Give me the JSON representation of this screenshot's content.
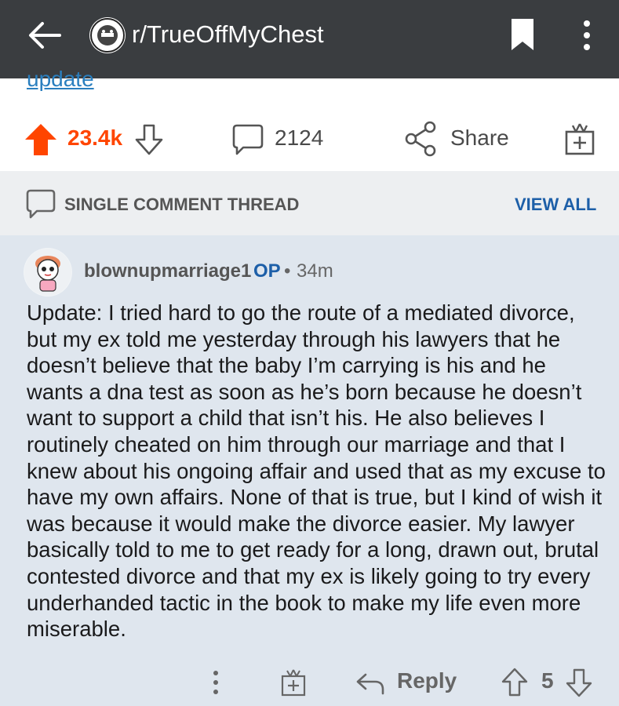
{
  "appbar": {
    "subreddit": "r/TrueOffMyChest"
  },
  "post": {
    "cutoff_text": "update",
    "score": "23.4k",
    "comment_count": "2124",
    "share_label": "Share"
  },
  "thread": {
    "label": "SINGLE COMMENT THREAD",
    "view_all": "VIEW ALL"
  },
  "comment": {
    "username": "blownupmarriage1",
    "op_badge": "OP",
    "separator": "•",
    "time": "34m",
    "body": "Update: I tried hard to go the route of a mediated divorce, but my ex told me yesterday through his lawyers that he doesn’t believe that the baby I’m carrying is his and he wants a dna test as soon as he’s born because he doesn’t want to support a child that isn’t his. He also believes I routinely cheated on him through our marriage and that I knew about his ongoing affair and used that as my excuse to have my own affairs. None of that is true, but I kind of wish it was because it would make the divorce easier. My lawyer basically told to me to get ready for a long, drawn out, brutal contested divorce and that my ex is likely going to try every underhanded tactic in the book to make my life even more miserable.",
    "reply_label": "Reply",
    "score": "5"
  },
  "colors": {
    "appbar": "#3a3d40",
    "upvote": "#ff4500",
    "link_blue": "#1d5fa8",
    "comment_bg": "#dfe6ee"
  },
  "icons": [
    "back-arrow-icon",
    "subreddit-avatar-icon",
    "bookmark-icon",
    "more-vertical-icon",
    "upvote-icon",
    "downvote-icon",
    "comment-icon",
    "share-icon",
    "award-icon",
    "reply-icon"
  ]
}
